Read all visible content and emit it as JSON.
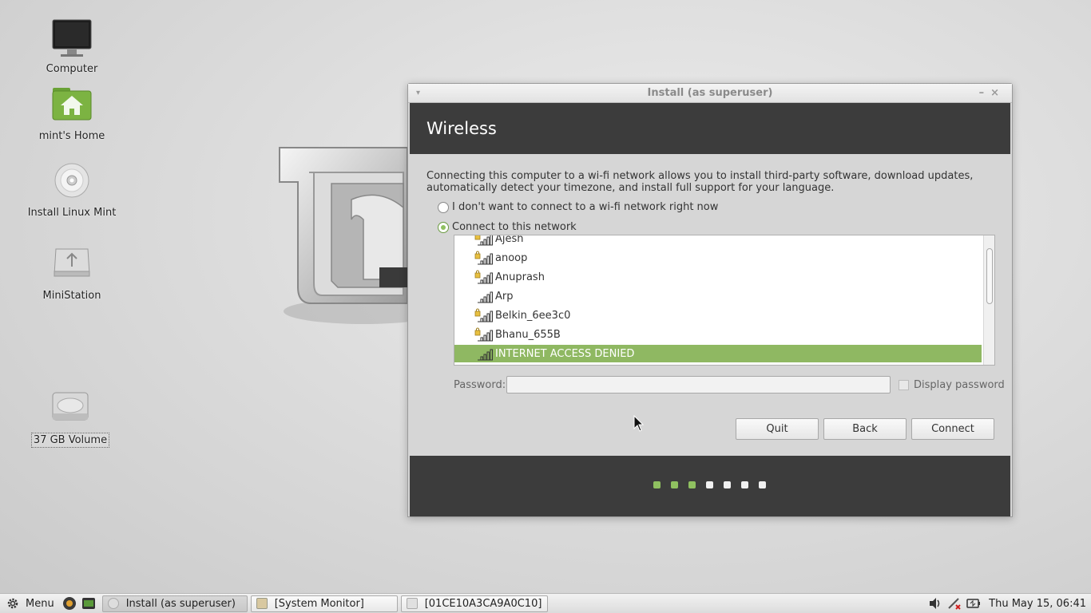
{
  "desktop": {
    "icons": [
      {
        "label": "Computer",
        "icon": "monitor-icon"
      },
      {
        "label": "mint's Home",
        "icon": "home-folder-icon"
      },
      {
        "label": "Install Linux Mint",
        "icon": "cd-icon"
      },
      {
        "label": "MiniStation",
        "icon": "usb-drive-icon"
      },
      {
        "label": "37 GB Volume",
        "icon": "hard-disk-icon"
      }
    ]
  },
  "window": {
    "title": "Install (as superuser)",
    "header": "Wireless",
    "description": "Connecting this computer to a wi-fi network allows you to install third-party software, download updates, automatically detect your timezone, and install full support for your language.",
    "option_no_connect": "I don't want to connect to a wi-fi network right now",
    "option_connect": "Connect to this network",
    "selected_option": "connect",
    "networks": [
      {
        "name": "Ajesh",
        "locked": true
      },
      {
        "name": "anoop",
        "locked": true
      },
      {
        "name": "Anuprash",
        "locked": true
      },
      {
        "name": "Arp",
        "locked": false
      },
      {
        "name": "Belkin_6ee3c0",
        "locked": true
      },
      {
        "name": "Bhanu_655B",
        "locked": true
      },
      {
        "name": "INTERNET ACCESS DENIED",
        "locked": false,
        "selected": true
      }
    ],
    "password_label": "Password:",
    "password_value": "",
    "display_password_label": "Display password",
    "buttons": {
      "quit": "Quit",
      "back": "Back",
      "connect": "Connect"
    },
    "progress": {
      "total_steps": 7,
      "completed_steps": 3
    }
  },
  "taskbar": {
    "menu_label": "Menu",
    "tasks": [
      {
        "label": "Install (as superuser)",
        "active": true
      },
      {
        "label": "[System Monitor]",
        "active": false
      },
      {
        "label": "[01CE10A3CA9A0C10]",
        "active": false
      }
    ],
    "clock": "Thu May 15, 06:41"
  },
  "colors": {
    "accent_green": "#8fc060",
    "selection_green": "#8fb862",
    "header_dark": "#3c3c3c"
  }
}
